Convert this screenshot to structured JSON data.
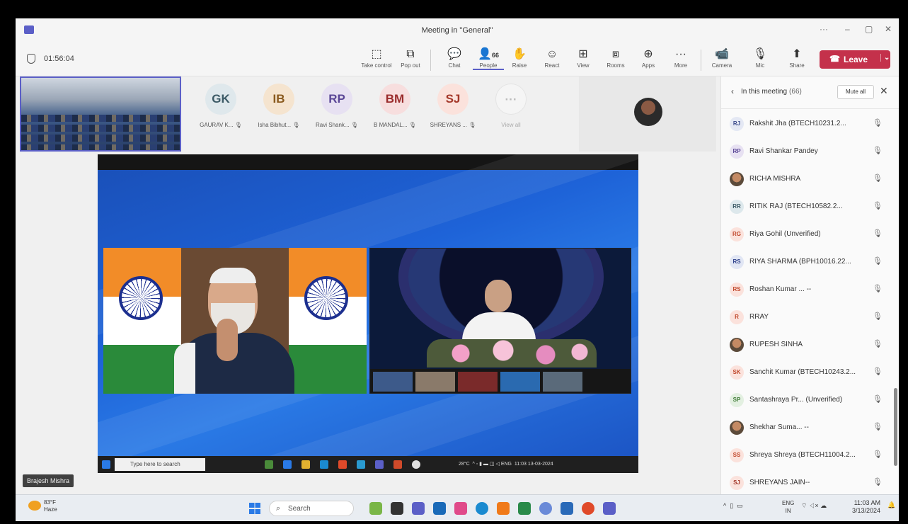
{
  "window": {
    "title": "Meeting in \"General\"",
    "controls": {
      "more": "···",
      "minimize": "–",
      "restore": "▢",
      "close": "✕"
    }
  },
  "toolbar": {
    "timer": "01:56:04",
    "buttons": [
      {
        "label": "Take control",
        "icon": "take-control-icon",
        "glyph": "⬚"
      },
      {
        "label": "Pop out",
        "icon": "pop-out-icon",
        "glyph": "⧉"
      },
      {
        "label": "Chat",
        "icon": "chat-icon",
        "glyph": "💬"
      },
      {
        "label": "People",
        "icon": "people-icon",
        "glyph": "👤",
        "badge": "66"
      },
      {
        "label": "Raise",
        "icon": "raise-hand-icon",
        "glyph": "✋"
      },
      {
        "label": "React",
        "icon": "react-icon",
        "glyph": "☺"
      },
      {
        "label": "View",
        "icon": "view-icon",
        "glyph": "⊞"
      },
      {
        "label": "Rooms",
        "icon": "rooms-icon",
        "glyph": "⧈"
      },
      {
        "label": "Apps",
        "icon": "apps-icon",
        "glyph": "⊕"
      },
      {
        "label": "More",
        "icon": "more-icon",
        "glyph": "···"
      },
      {
        "label": "Camera",
        "icon": "camera-off-icon",
        "glyph": "📹"
      },
      {
        "label": "Mic",
        "icon": "mic-off-icon",
        "glyph": "🎙"
      },
      {
        "label": "Share",
        "icon": "share-icon",
        "glyph": "⬆"
      }
    ],
    "leave_label": "Leave"
  },
  "gallery": {
    "participants": [
      {
        "initials": "GK",
        "name": "GAURAV K...",
        "bg": "#dfe8ec",
        "fg": "#3c5a66"
      },
      {
        "initials": "IB",
        "name": "Isha Bibhut...",
        "bg": "#f5e4cf",
        "fg": "#8a5a1e"
      },
      {
        "initials": "RP",
        "name": "Ravi Shank...",
        "bg": "#e7e1f2",
        "fg": "#5a4696"
      },
      {
        "initials": "BM",
        "name": "B MANDAL...",
        "bg": "#f7dede",
        "fg": "#9a2c2c"
      },
      {
        "initials": "SJ",
        "name": "SHREYANS ...",
        "bg": "#fbe2dc",
        "fg": "#a4382a"
      }
    ],
    "view_all": "View all"
  },
  "share": {
    "inner_search": "Type here to search",
    "inner_weather": "28°C",
    "inner_time": "11:03",
    "inner_date": "13-03-2024"
  },
  "stage": {
    "self_name": "Brajesh Mishra"
  },
  "sidebar": {
    "title": "In this meeting",
    "count": "(66)",
    "mute_all": "Mute all",
    "people": [
      {
        "initials": "RJ",
        "name": "Rakshit Jha (BTECH10231.2...",
        "bg": "#e4e8f4",
        "fg": "#3a4a8a"
      },
      {
        "initials": "RP",
        "name": "Ravi Shankar Pandey",
        "bg": "#e7e1f2",
        "fg": "#5a4696"
      },
      {
        "initials": "",
        "name": "RICHA MISHRA",
        "photo": true
      },
      {
        "initials": "RR",
        "name": "RITIK RAJ (BTECH10582.2...",
        "bg": "#dde8ec",
        "fg": "#3c5a66"
      },
      {
        "initials": "RG",
        "name": "Riya Gohil (Unverified)",
        "bg": "#fbe2dc",
        "fg": "#c0462a"
      },
      {
        "initials": "RS",
        "name": "RIYA SHARMA (BPH10016.22...",
        "bg": "#e1e6f4",
        "fg": "#2c3f8a"
      },
      {
        "initials": "RS",
        "name": "Roshan Kumar ... --",
        "bg": "#fbe2dc",
        "fg": "#c0462a"
      },
      {
        "initials": "R",
        "name": "RRAY",
        "bg": "#fbe2dc",
        "fg": "#c0462a"
      },
      {
        "initials": "",
        "name": "RUPESH SINHA",
        "photo": true
      },
      {
        "initials": "SK",
        "name": "Sanchit Kumar (BTECH10243.2...",
        "bg": "#fbe2dc",
        "fg": "#c0462a"
      },
      {
        "initials": "SP",
        "name": "Santashraya Pr... (Unverified)",
        "bg": "#e3f0e1",
        "fg": "#3f7a36"
      },
      {
        "initials": "",
        "name": "Shekhar Suma... --",
        "photo": true
      },
      {
        "initials": "SS",
        "name": "Shreya Shreya (BTECH11004.2...",
        "bg": "#fbe2dc",
        "fg": "#c0462a"
      },
      {
        "initials": "SJ",
        "name": "SHREYANS JAIN--",
        "bg": "#fbe2dc",
        "fg": "#a4382a"
      }
    ]
  },
  "taskbar": {
    "weather_temp": "83°F",
    "weather_desc": "Haze",
    "search": "Search",
    "lang_1": "ENG",
    "lang_2": "IN",
    "time": "11:03 AM",
    "date": "3/13/2024"
  },
  "colors": {
    "accent": "#5b5fc7",
    "leave": "#c4314b"
  }
}
